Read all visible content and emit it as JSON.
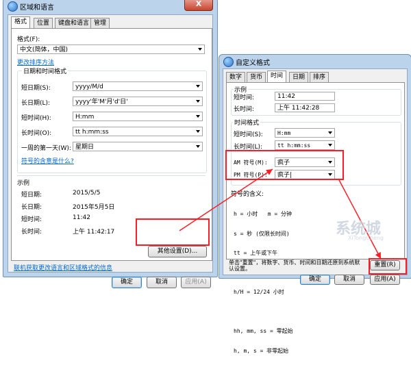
{
  "left_window": {
    "title": "区域和语言",
    "close_glyph": "X",
    "tabs": [
      "格式",
      "位置",
      "键盘和语言",
      "管理"
    ],
    "format_label": "格式(F):",
    "format_value": "中文(简体，中国)",
    "change_sort_link": "更改排序方法",
    "datetime_group": "日期和时间格式",
    "rows": [
      {
        "label": "短日期(S):",
        "value": "yyyy/M/d"
      },
      {
        "label": "长日期(L):",
        "value": "yyyy'年'M'月'd'日'"
      },
      {
        "label": "短时间(H):",
        "value": "H:mm"
      },
      {
        "label": "长时间(O):",
        "value": "tt h:mm:ss"
      },
      {
        "label": "一周的第一天(W):",
        "value": "星期日"
      }
    ],
    "symbol_meaning_link": "符号的含意是什么?",
    "example_title": "示例",
    "examples": [
      {
        "label": "短日期:",
        "value": "2015/5/5"
      },
      {
        "label": "长日期:",
        "value": "2015年5月5日"
      },
      {
        "label": "短时间:",
        "value": "11:42"
      },
      {
        "label": "长时间:",
        "value": "上午 11:42:17"
      }
    ],
    "other_settings_button": "其他设置(D)...",
    "online_link": "联机获取更改语言和区域格式的信息",
    "ok": "确定",
    "cancel": "取消",
    "apply": "应用(A)"
  },
  "right_window": {
    "title": "自定义格式",
    "tabs": [
      "数字",
      "货币",
      "时间",
      "日期",
      "排序"
    ],
    "example_title": "示例",
    "examples": [
      {
        "label": "短时间:",
        "value": "11:42"
      },
      {
        "label": "长时间:",
        "value": "上午 11:42:28"
      }
    ],
    "time_format_title": "时间格式",
    "formats": [
      {
        "label": "短时间(S):",
        "value": "H:mm"
      },
      {
        "label": "长时间(L):",
        "value": "tt h:mm:ss"
      }
    ],
    "am_label": "AM 符号(M):",
    "am_value": "疯子",
    "pm_label": "PM 符号(P):",
    "pm_value": "疯子|",
    "meaning_title": "符号的含义:",
    "meaning_lines": [
      "h = 小时   m = 分钟",
      "s = 秒 (仅限长时间)",
      "tt = 上午或下午",
      "",
      "h/H = 12/24 小时",
      "",
      "hh, mm, ss = 零起始",
      "h, m, s = 非零起始"
    ],
    "reset_note": "单击\"重置\"，将数字、货币、时间和日期还原到系统默认设置。",
    "reset_button": "重置(R)",
    "ok": "确定",
    "cancel": "取消",
    "apply": "应用(A)"
  },
  "watermark": {
    "text": "系统城",
    "sub": "XiTongCheng"
  },
  "colors": {
    "highlight_red": "#ff1d25",
    "link_blue": "#0066cc",
    "title_blue": "#bcd3ec"
  }
}
